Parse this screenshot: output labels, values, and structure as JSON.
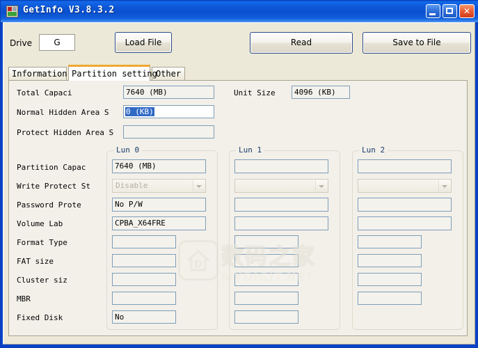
{
  "window": {
    "title": "GetInfo V3.8.3.2",
    "icon": "app-icon",
    "minimize_label": "",
    "maximize_label": "",
    "close_label": "✕"
  },
  "toolbar": {
    "drive_label": "Drive",
    "drive_value": "G",
    "load_file_label": "Load File",
    "read_label": "Read",
    "save_to_file_label": "Save to File"
  },
  "tabs": [
    {
      "label": "Information",
      "active": false
    },
    {
      "label": "Partition setting",
      "active": true
    },
    {
      "label": "Other",
      "active": false
    }
  ],
  "top_fields": {
    "total_capacity_label": "Total Capaci",
    "total_capacity_value": "7640 (MB)",
    "unit_size_label": "Unit Size",
    "unit_size_value": "4096 (KB)",
    "normal_hidden_label": "Normal Hidden Area S",
    "normal_hidden_value": "0 (KB)",
    "protect_hidden_label": "Protect Hidden Area S",
    "protect_hidden_value": ""
  },
  "row_labels": [
    "Partition Capac",
    "Write Protect St",
    "Password Prote",
    "Volume Lab",
    "Format Type",
    "FAT size",
    "Cluster siz",
    "MBR",
    "Fixed Disk"
  ],
  "luns": [
    {
      "title": "Lun 0",
      "partition_capacity": "7640 (MB)",
      "write_protect_status": "Disable",
      "password_protect": "No P/W",
      "volume_label": "CPBA_X64FRE",
      "format_type": "",
      "fat_size": "",
      "cluster_size": "",
      "mbr": "",
      "fixed_disk": "No",
      "has_fixed_disk": true
    },
    {
      "title": "Lun 1",
      "partition_capacity": "",
      "write_protect_status": "",
      "password_protect": "",
      "volume_label": "",
      "format_type": "",
      "fat_size": "",
      "cluster_size": "",
      "mbr": "",
      "fixed_disk": "",
      "has_fixed_disk": true
    },
    {
      "title": "Lun 2",
      "partition_capacity": "",
      "write_protect_status": "",
      "password_protect": "",
      "volume_label": "",
      "format_type": "",
      "fat_size": "",
      "cluster_size": "",
      "mbr": "",
      "fixed_disk": "",
      "has_fixed_disk": false
    }
  ],
  "watermark": {
    "chinese_text": "数码之家",
    "latin_text": "MYDIGIT.NET"
  },
  "colors": {
    "titlebar_blue": "#0a4fd0",
    "client_bg": "#ece9d8",
    "tabpage_bg": "#f2f0e9",
    "active_tab_accent": "#f0a830",
    "input_border": "#7f9db9",
    "selection_blue": "#316ac5",
    "group_title": "#1a3a6b"
  }
}
